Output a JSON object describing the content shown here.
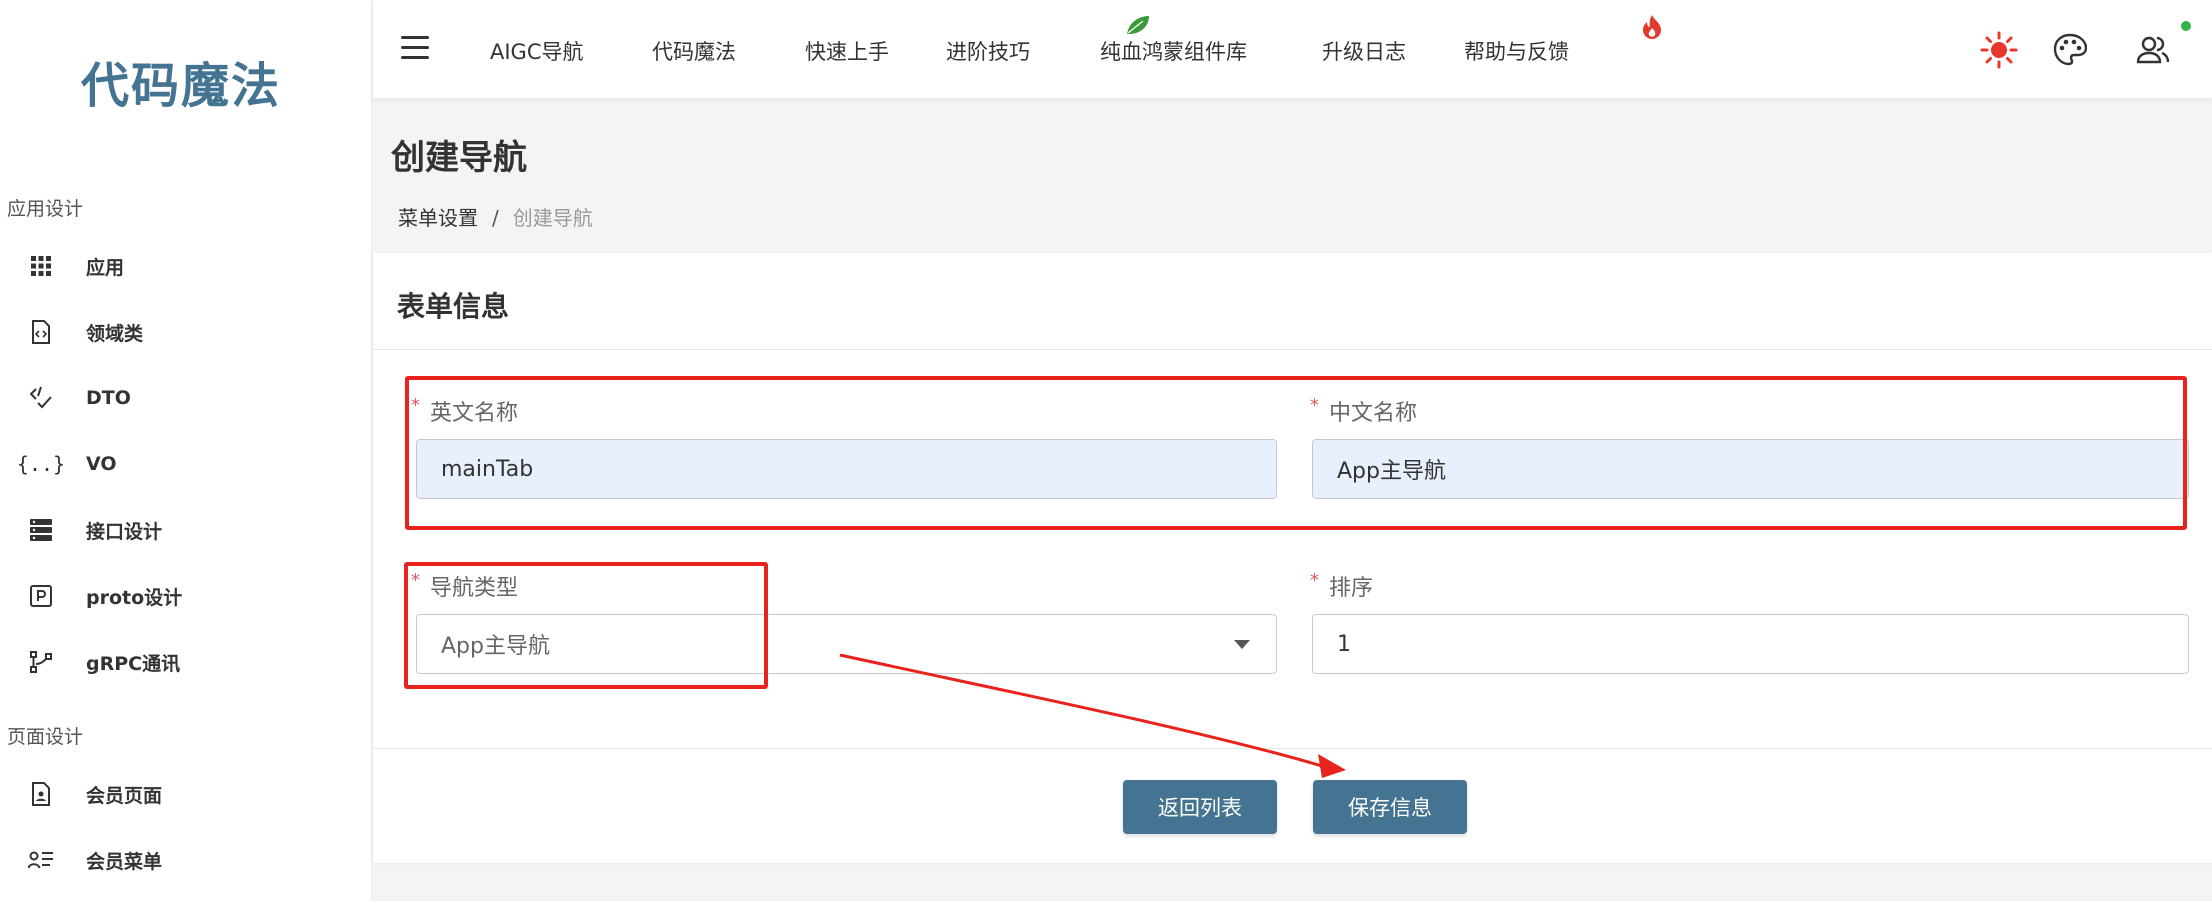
{
  "sidebar": {
    "logo": "代码魔法",
    "section1": "应用设计",
    "section2": "页面设计",
    "items": [
      {
        "label": "应用",
        "icon": "grid-icon"
      },
      {
        "label": "领域类",
        "icon": "code-file-icon"
      },
      {
        "label": "DTO",
        "icon": "code-check-icon"
      },
      {
        "label": "VO",
        "icon": "braces-icon"
      },
      {
        "label": "接口设计",
        "icon": "server-icon"
      },
      {
        "label": "proto设计",
        "icon": "p-box-icon"
      },
      {
        "label": "gRPC通讯",
        "icon": "branch-icon"
      },
      {
        "label": "会员页面",
        "icon": "user-file-icon"
      },
      {
        "label": "会员菜单",
        "icon": "user-list-icon"
      }
    ]
  },
  "topbar": {
    "nav": [
      "AIGC导航",
      "代码魔法",
      "快速上手",
      "进阶技巧",
      "纯血鸿蒙组件库",
      "升级日志",
      "帮助与反馈"
    ],
    "icons": [
      "sun-icon",
      "palette-icon",
      "users-icon"
    ],
    "sun_color": "#e8362c"
  },
  "page": {
    "title": "创建导航",
    "breadcrumb": {
      "parent": "菜单设置",
      "separator": "/",
      "current": "创建导航"
    }
  },
  "form": {
    "title": "表单信息",
    "required_mark": "*",
    "en_name": {
      "label": "英文名称",
      "value": "mainTab"
    },
    "cn_name": {
      "label": "中文名称",
      "value": "App主导航"
    },
    "nav_type": {
      "label": "导航类型",
      "value": "App主导航"
    },
    "sort": {
      "label": "排序",
      "value": "1"
    },
    "back_button": "返回列表",
    "save_button": "保存信息"
  },
  "colors": {
    "accent": "#447491",
    "annotation": "#e8221c"
  }
}
